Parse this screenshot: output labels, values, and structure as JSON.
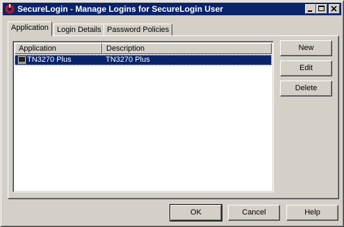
{
  "window": {
    "title": "SecureLogin - Manage Logins for SecureLogin User"
  },
  "tabs": [
    {
      "label": "Application",
      "active": true
    },
    {
      "label": "Login Details",
      "active": false
    },
    {
      "label": "Password Policies",
      "active": false
    }
  ],
  "list": {
    "columns": [
      "Application",
      "Description"
    ],
    "rows": [
      {
        "application": "TN3270 Plus",
        "description": "TN3270 Plus",
        "selected": true
      }
    ]
  },
  "side_buttons": {
    "new": "New",
    "edit": "Edit",
    "delete": "Delete"
  },
  "footer_buttons": {
    "ok": "OK",
    "cancel": "Cancel",
    "help": "Help"
  },
  "colors": {
    "titlebar": "#0a246a",
    "face": "#d4d0c8",
    "selection": "#0a246a",
    "app_icon": "#c0161b"
  },
  "icons": {
    "app": "securelogin-logo-icon",
    "row": "terminal-app-icon",
    "minimize": "minimize-icon",
    "maximize": "maximize-icon",
    "close": "close-icon"
  }
}
